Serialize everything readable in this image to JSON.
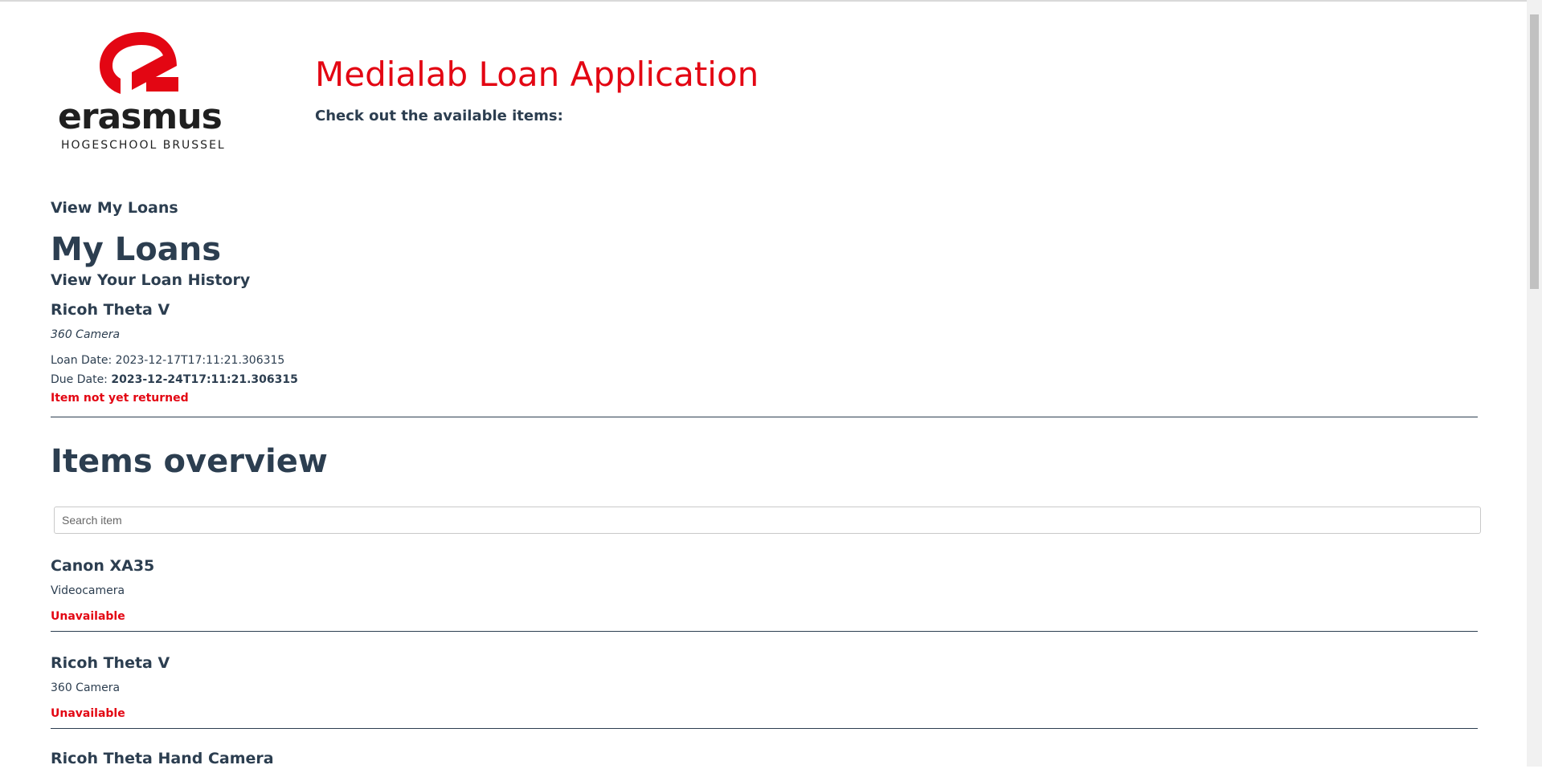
{
  "header": {
    "logo_word": "erasmus",
    "logo_sub": "HOGESCHOOL  BRUSSEL",
    "title": "Medialab Loan Application",
    "subtitle": "Check out the available items:"
  },
  "my_loans": {
    "view_link": "View My Loans",
    "heading": "My Loans",
    "history_link": "View Your Loan History",
    "loans": [
      {
        "name": "Ricoh Theta V",
        "category": "360 Camera",
        "loan_label": "Loan Date: ",
        "loan_date": "2023-12-17T17:11:21.306315",
        "due_label": "Due Date: ",
        "due_date": "2023-12-24T17:11:21.306315",
        "status": "Item not yet returned"
      }
    ]
  },
  "items_overview": {
    "heading": "Items overview",
    "search_placeholder": "Search item",
    "items": [
      {
        "name": "Canon XA35",
        "category": "Videocamera",
        "status": "Unavailable"
      },
      {
        "name": "Ricoh Theta V",
        "category": "360 Camera",
        "status": "Unavailable"
      },
      {
        "name": "Ricoh Theta Hand Camera",
        "category": "",
        "status": ""
      }
    ]
  },
  "colors": {
    "brand_red": "#e30613",
    "text": "#2c3e50"
  }
}
